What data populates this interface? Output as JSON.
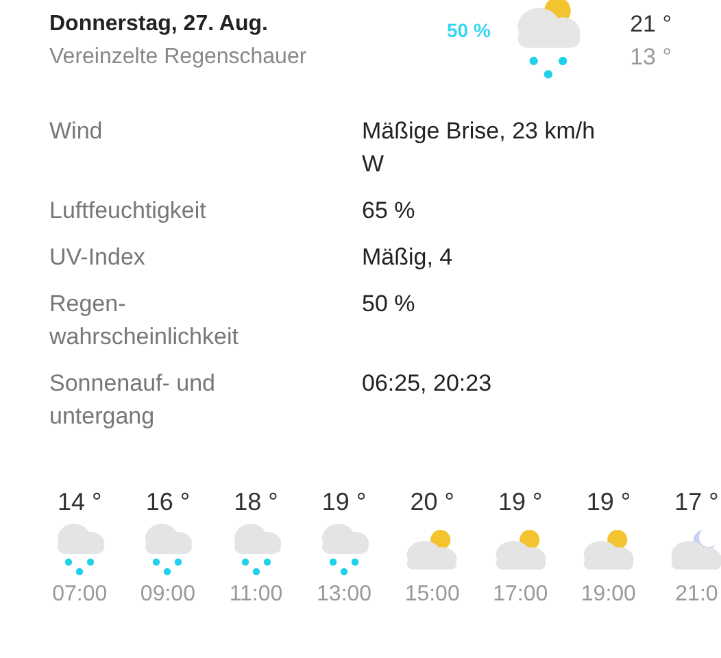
{
  "day": {
    "date": "Donnerstag, 27. Aug.",
    "condition": "Vereinzelte Regenschauer",
    "precipitation": "50 %",
    "kind": "showers",
    "high": "21 °",
    "low": "13 °"
  },
  "details": [
    {
      "label": "Wind",
      "value": "Mäßige Brise, 23 km/h W"
    },
    {
      "label": "Luftfeuchtigkeit",
      "value": "65 %"
    },
    {
      "label": "UV-Index",
      "value": "Mäßig, 4"
    },
    {
      "label": "Regen-wahrscheinlichkeit",
      "value": "50 %"
    },
    {
      "label": "Sonnenauf- und untergang",
      "value": "06:25, 20:23"
    }
  ],
  "hourly": [
    {
      "temp": "14 °",
      "kind": "rain",
      "time": "07:00"
    },
    {
      "temp": "16 °",
      "kind": "rain",
      "time": "09:00"
    },
    {
      "temp": "18 °",
      "kind": "rain",
      "time": "11:00"
    },
    {
      "temp": "19 °",
      "kind": "rain",
      "time": "13:00"
    },
    {
      "temp": "20 °",
      "kind": "sunny",
      "time": "15:00"
    },
    {
      "temp": "19 °",
      "kind": "sunny",
      "time": "17:00"
    },
    {
      "temp": "19 °",
      "kind": "sunny",
      "time": "19:00"
    },
    {
      "temp": "17 °",
      "kind": "night",
      "time": "21:0"
    }
  ]
}
